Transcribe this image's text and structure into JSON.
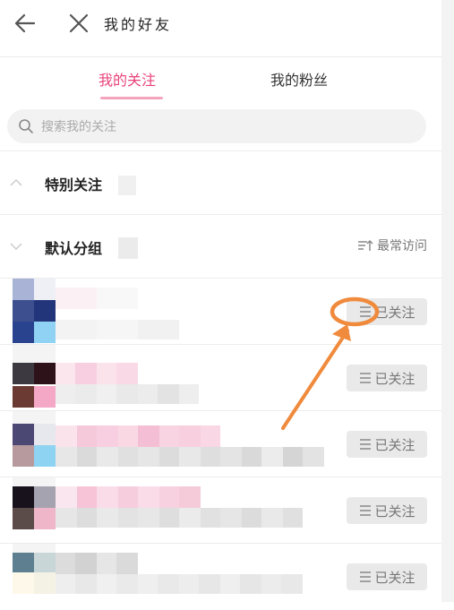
{
  "header": {
    "title": "我的好友"
  },
  "tabs": [
    {
      "label": "我的关注",
      "active": true
    },
    {
      "label": "我的粉丝",
      "active": false
    }
  ],
  "search": {
    "placeholder": "搜索我的关注",
    "value": ""
  },
  "groups": {
    "special": {
      "title": "特别关注"
    },
    "default": {
      "title": "默认分组",
      "sort_label": "最常访问"
    }
  },
  "friends": [
    {
      "action_label": "已关注"
    },
    {
      "action_label": "已关注"
    },
    {
      "action_label": "已关注"
    },
    {
      "action_label": "已关注"
    },
    {
      "action_label": "已关注"
    }
  ],
  "colors": {
    "accent": "#e8437a",
    "tab_indicator": "#f4a5bd",
    "annotation": "#f08a3c"
  },
  "icons": [
    "back-arrow-icon",
    "close-icon",
    "search-icon",
    "chevron-up-icon",
    "chevron-down-icon",
    "sort-icon",
    "menu-lines-icon"
  ]
}
